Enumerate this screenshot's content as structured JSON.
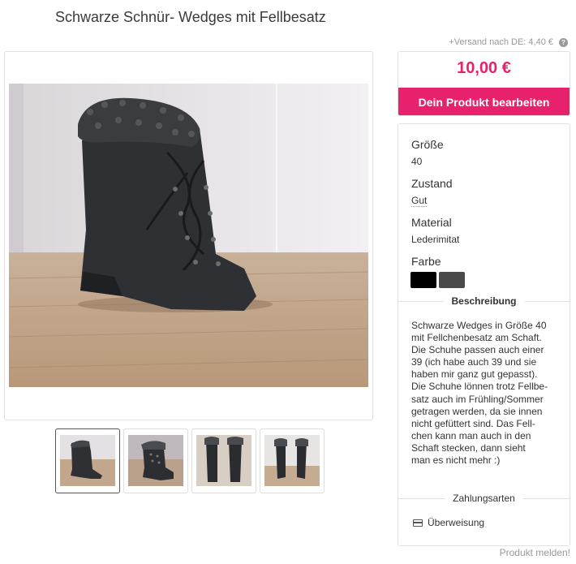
{
  "product": {
    "title": "Schwarze Schnür- Wedges mit Fellbesatz",
    "shipping": "+Versand nach DE: 4,40 €",
    "help_icon": "?",
    "price": "10,00 €",
    "edit_button": "Dein Produkt bearbeiten",
    "report_link": "Produkt melden!"
  },
  "attributes": {
    "size_label": "Größe",
    "size_value": "40",
    "condition_label": "Zustand",
    "condition_value": "Gut",
    "material_label": "Material",
    "material_value": "Lederimitat",
    "color_label": "Farbe",
    "colors": [
      "#000000",
      "#4a4a4a"
    ]
  },
  "description": {
    "heading": "Beschreibung",
    "text": "Schwarze Wedges in Größe 40\nmit Fellchenbesatz am Schaft.\nDie Schuhe passen auch einer\n39 (ich habe auch 39 und sie\nhaben mir ganz gut gepasst).\nDie Schuhe lönnen trotz Fellbe-\nsatz auch im Frühling/Sommer\ngetragen werden, da sie innen\nnicht gefüttert sind. Das Fell-\nchen kann man auch in den\nSchaft stecken, dann sieht\nman es nicht mehr :)"
  },
  "payment": {
    "heading": "Zahlungsarten",
    "method": "Überweisung",
    "icon": "credit-card-icon"
  },
  "colors": {
    "accent": "#e8216d",
    "border": "#e1e1e1"
  }
}
